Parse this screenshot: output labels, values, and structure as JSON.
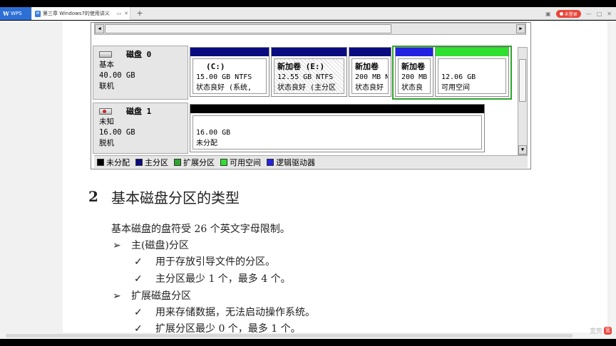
{
  "app": {
    "name": "WPS",
    "tab_title": "第三章 Windows7的使用讲义",
    "doc_icon": "W",
    "login_label": "未登录",
    "window_controls": [
      "—",
      "□",
      "✕"
    ]
  },
  "disk_manager": {
    "disks": [
      {
        "name": "磁盘 0",
        "type": "基本",
        "size": "40.00 GB",
        "status": "联机",
        "partitions": [
          {
            "label": "(C:)",
            "size": "15.00 GB NTFS",
            "state": "状态良好 (系统,",
            "bar_color": "#0b0b80"
          },
          {
            "label": "新加卷 (E:)",
            "size": "12.55 GB NTFS",
            "state": "状态良好 (主分区",
            "bar_color": "#0b0b80"
          },
          {
            "label": "新加卷",
            "size": "200 MB N",
            "state": "状态良好",
            "bar_color": "#0b0b80"
          },
          {
            "label": "新加卷",
            "size": "200 MB",
            "state": "状态良",
            "bar_color": "#2222e0"
          },
          {
            "label": "",
            "size": "12.06 GB",
            "state": "可用空间",
            "bar_color": "#30e030"
          }
        ]
      },
      {
        "name": "磁盘 1",
        "type": "未知",
        "size": "16.00 GB",
        "status": "脱机",
        "partitions": [
          {
            "label": "",
            "size": "16.00 GB",
            "state": "未分配",
            "bar_color": "#000000"
          }
        ]
      }
    ],
    "legend": [
      {
        "label": "未分配",
        "color": "#000000"
      },
      {
        "label": "主分区",
        "color": "#0b0b80"
      },
      {
        "label": "扩展分区",
        "color": "#2ea52e"
      },
      {
        "label": "可用空间",
        "color": "#30e030"
      },
      {
        "label": "逻辑驱动器",
        "color": "#2222e0"
      }
    ]
  },
  "section": {
    "number": "2",
    "title": "基本磁盘分区的类型",
    "intro": "基本磁盘的盘符受 26 个英文字母限制。",
    "items": [
      {
        "bullet": "➢",
        "text": "主(磁盘)分区",
        "level": 1
      },
      {
        "bullet": "✓",
        "text": "用于存放引导文件的分区。",
        "level": 2
      },
      {
        "bullet": "✓",
        "text": "主分区最少 1 个，最多 4 个。",
        "level": 2
      },
      {
        "bullet": "➢",
        "text": "扩展磁盘分区",
        "level": 1
      },
      {
        "bullet": "✓",
        "text": "用来存储数据，无法启动操作系统。",
        "level": 2
      },
      {
        "bullet": "✓",
        "text": "扩展分区最少 0 个，最多 1 个。",
        "level": 2
      }
    ]
  },
  "status": {
    "brand": "宽势"
  }
}
